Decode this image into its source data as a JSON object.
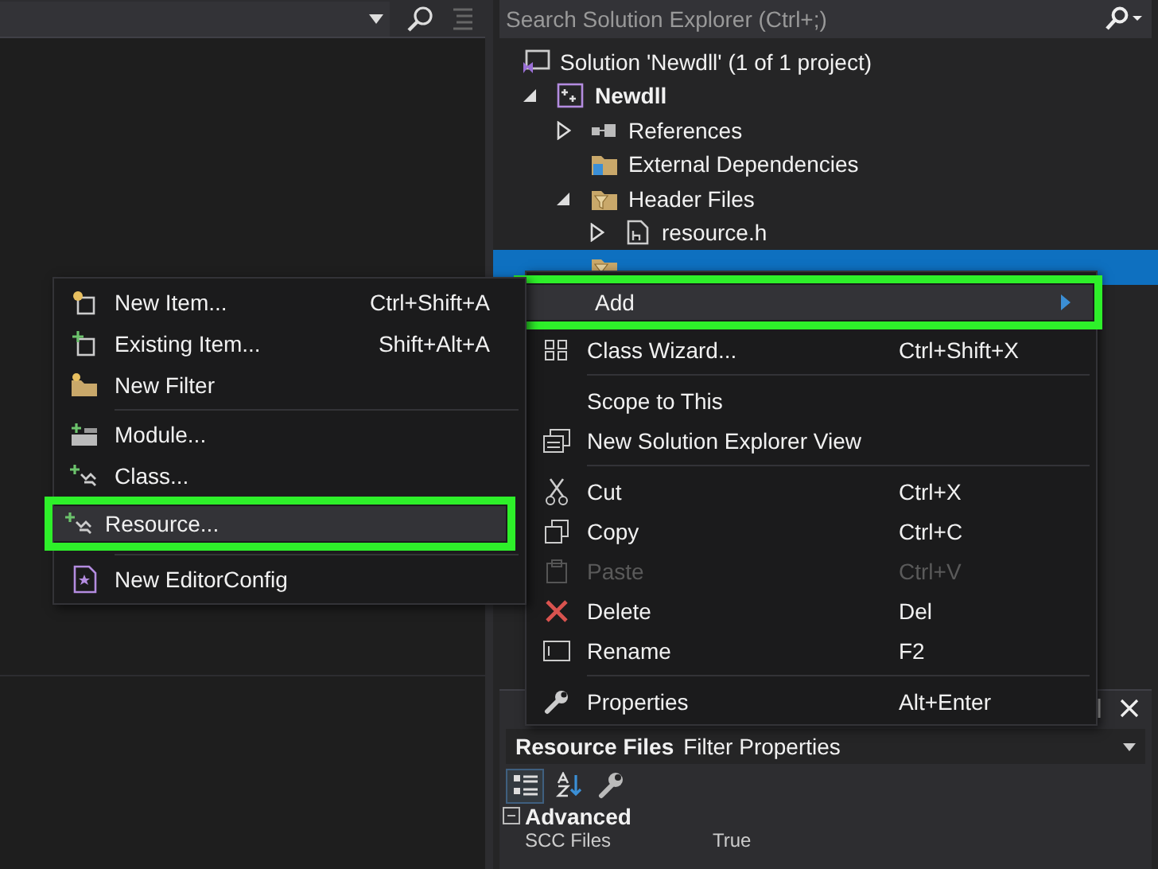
{
  "solution_explorer": {
    "search": {
      "placeholder": "Search Solution Explorer (Ctrl+;)"
    },
    "tree": [
      {
        "label": "Solution 'Newdll' (1 of 1 project)",
        "kind": "solution",
        "selected": false,
        "children": [
          {
            "label": "Newdll",
            "kind": "project",
            "expanded": true,
            "selected": false,
            "children": [
              {
                "label": "References",
                "kind": "references",
                "expanded": false,
                "selected": false
              },
              {
                "label": "External Dependencies",
                "kind": "dependencies",
                "selected": false
              },
              {
                "label": "Header Files",
                "kind": "filter",
                "expanded": true,
                "selected": false,
                "children": [
                  {
                    "label": "resource.h",
                    "kind": "header",
                    "expanded": false,
                    "selected": false
                  }
                ]
              },
              {
                "kind": "filter",
                "selected": true
              }
            ]
          }
        ]
      }
    ]
  },
  "context_menu": {
    "items": [
      {
        "kind": "item",
        "label": "Add",
        "submenu": true,
        "disabled": false,
        "highlighted": true
      },
      {
        "kind": "item",
        "label": "Class Wizard...",
        "shortcut": "Ctrl+Shift+X",
        "submenu": false,
        "disabled": false,
        "highlighted": false
      },
      {
        "kind": "separator"
      },
      {
        "kind": "item",
        "label": "Scope to This",
        "submenu": false,
        "disabled": false,
        "highlighted": false
      },
      {
        "kind": "item",
        "label": "New Solution Explorer View",
        "submenu": false,
        "disabled": false,
        "highlighted": false
      },
      {
        "kind": "separator"
      },
      {
        "kind": "item",
        "label": "Cut",
        "shortcut": "Ctrl+X",
        "submenu": false,
        "disabled": false,
        "highlighted": false
      },
      {
        "kind": "item",
        "label": "Copy",
        "shortcut": "Ctrl+C",
        "submenu": false,
        "disabled": false,
        "highlighted": false
      },
      {
        "kind": "item",
        "label": "Paste",
        "shortcut": "Ctrl+V",
        "submenu": false,
        "disabled": true,
        "highlighted": false
      },
      {
        "kind": "item",
        "label": "Delete",
        "shortcut": "Del",
        "submenu": false,
        "disabled": false,
        "highlighted": false
      },
      {
        "kind": "item",
        "label": "Rename",
        "shortcut": "F2",
        "submenu": false,
        "disabled": false,
        "highlighted": false
      },
      {
        "kind": "separator"
      },
      {
        "kind": "item",
        "label": "Properties",
        "shortcut": "Alt+Enter",
        "submenu": false,
        "disabled": false,
        "highlighted": false
      }
    ]
  },
  "add_submenu": {
    "items": [
      {
        "kind": "item",
        "label": "New Item...",
        "shortcut": "Ctrl+Shift+A",
        "disabled": false,
        "highlighted": false
      },
      {
        "kind": "item",
        "label": "Existing Item...",
        "shortcut": "Shift+Alt+A",
        "disabled": false,
        "highlighted": false
      },
      {
        "kind": "item",
        "label": "New Filter",
        "disabled": false,
        "highlighted": false
      },
      {
        "kind": "separator"
      },
      {
        "kind": "item",
        "label": "Module...",
        "disabled": false,
        "highlighted": false
      },
      {
        "kind": "item",
        "label": "Class...",
        "disabled": false,
        "highlighted": false
      },
      {
        "kind": "item",
        "label": "Resource...",
        "disabled": false,
        "highlighted": true
      },
      {
        "kind": "separator"
      },
      {
        "kind": "item",
        "label": "New EditorConfig",
        "disabled": false,
        "highlighted": false
      }
    ]
  },
  "properties": {
    "object_name": "Resource Files",
    "object_type": "Filter Properties",
    "view_buttons": [
      {
        "selected": true
      },
      {
        "selected": false
      },
      {
        "selected": false
      }
    ],
    "category": {
      "label": "Advanced",
      "expanded": true
    },
    "rows": [
      {
        "name": "SCC Files",
        "value": "True"
      }
    ]
  }
}
